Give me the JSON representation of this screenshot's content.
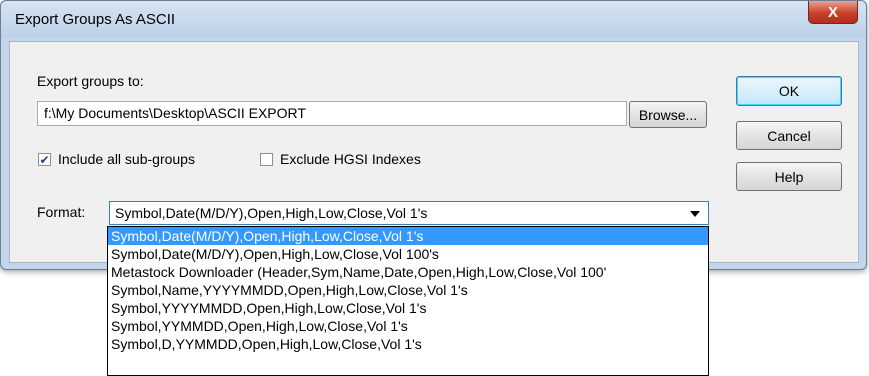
{
  "window": {
    "title": "Export Groups As ASCII",
    "close_label": "X"
  },
  "export": {
    "label": "Export groups to:",
    "path": "f:\\My Documents\\Desktop\\ASCII EXPORT",
    "browse_label": "Browse..."
  },
  "buttons": {
    "ok": "OK",
    "cancel": "Cancel",
    "help": "Help"
  },
  "options": {
    "include_subgroups": {
      "label": "Include all sub-groups",
      "checked": true,
      "mark": "✔"
    },
    "exclude_hgsi": {
      "label": "Exclude HGSI Indexes",
      "checked": false,
      "mark": ""
    }
  },
  "format": {
    "label": "Format:",
    "selected": "Symbol,Date(M/D/Y),Open,High,Low,Close,Vol 1's",
    "list": [
      "Symbol,Date(M/D/Y),Open,High,Low,Close,Vol 1's",
      "Symbol,Date(M/D/Y),Open,High,Low,Close,Vol 100's",
      "Metastock Downloader (Header,Sym,Name,Date,Open,High,Low,Close,Vol 100'",
      "Symbol,Name,YYYYMMDD,Open,High,Low,Close,Vol 1's",
      "Symbol,YYYYMMDD,Open,High,Low,Close,Vol 1's",
      "Symbol,YYMMDD,Open,High,Low,Close,Vol 1's",
      "Symbol,D,YYMMDD,Open,High,Low,Close,Vol 1's"
    ]
  },
  "colors": {
    "selection": "#3399ff",
    "window_frame": "#c2d5ea",
    "close": "#c7402a"
  }
}
